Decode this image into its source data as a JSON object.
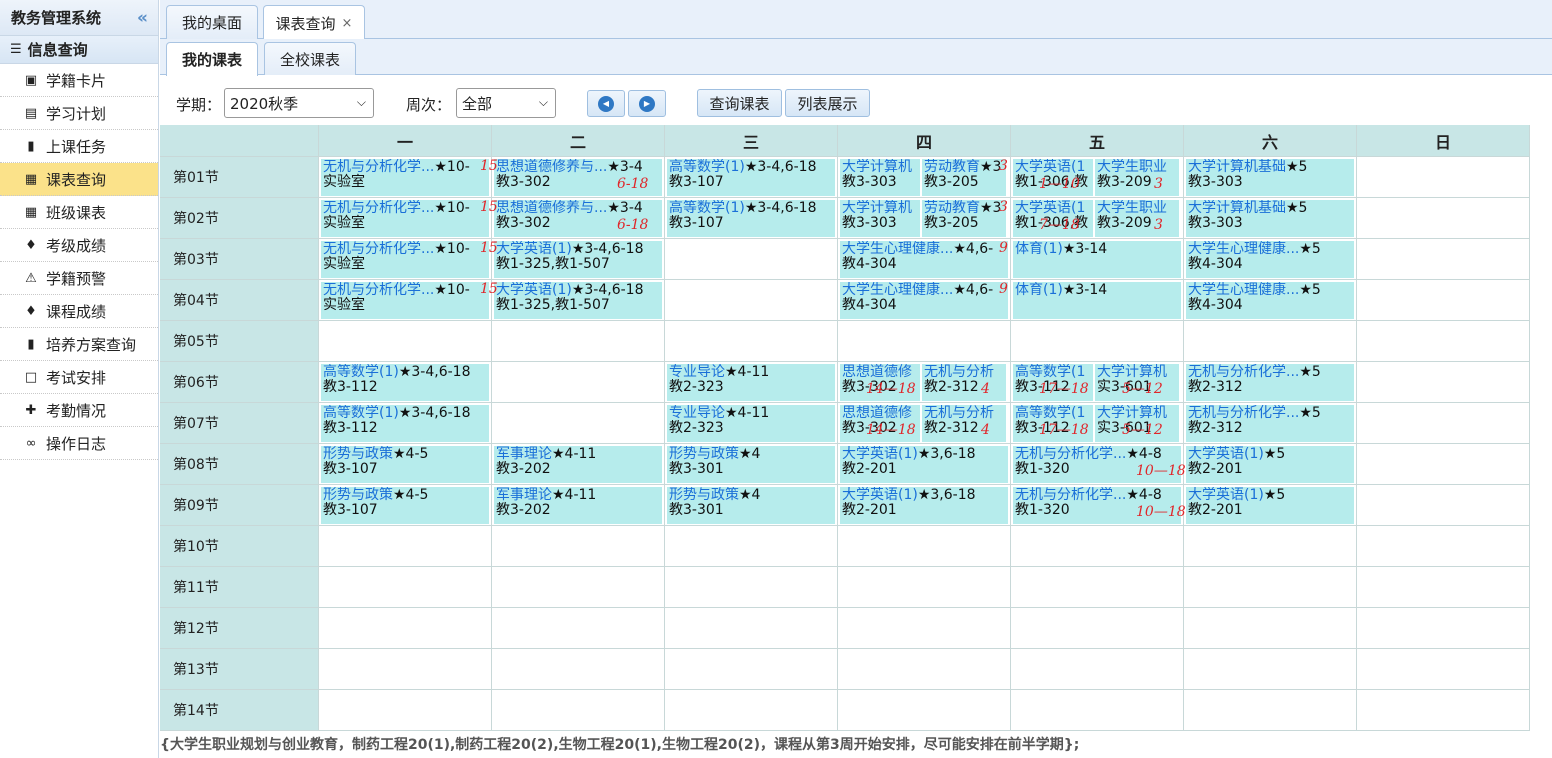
{
  "sidebar": {
    "title": "教务管理系统",
    "collapse_icon": "double-chevron-left-icon",
    "group": "信息查询",
    "items": [
      {
        "label": "学籍卡片",
        "icon": "id-card-icon",
        "glyph": "▣"
      },
      {
        "label": "学习计划",
        "icon": "keyboard-icon",
        "glyph": "▤"
      },
      {
        "label": "上课任务",
        "icon": "book-icon",
        "glyph": "▮"
      },
      {
        "label": "课表查询",
        "icon": "calendar-icon",
        "glyph": "▦"
      },
      {
        "label": "班级课表",
        "icon": "calendar-icon",
        "glyph": "▦"
      },
      {
        "label": "考级成绩",
        "icon": "graduation-cap-icon",
        "glyph": "♦"
      },
      {
        "label": "学籍预警",
        "icon": "warning-icon",
        "glyph": "⚠"
      },
      {
        "label": "课程成绩",
        "icon": "graduation-cap-icon",
        "glyph": "♦"
      },
      {
        "label": "培养方案查询",
        "icon": "book-icon",
        "glyph": "▮"
      },
      {
        "label": "考试安排",
        "icon": "calendar-empty-icon",
        "glyph": "□"
      },
      {
        "label": "考勤情况",
        "icon": "user-plus-icon",
        "glyph": "✚"
      },
      {
        "label": "操作日志",
        "icon": "binoculars-icon",
        "glyph": "∞"
      }
    ],
    "active_index": 3
  },
  "tabs": {
    "home": "我的桌面",
    "current": "课表查询",
    "close": "×"
  },
  "subtabs": {
    "mine": "我的课表",
    "school": "全校课表"
  },
  "toolbar": {
    "term_label": "学期：",
    "term_value": "2020秋季",
    "week_label": "周次：",
    "week_value": "全部",
    "query_button": "查询课表",
    "list_button": "列表展示",
    "accent": "#2f78c4"
  },
  "timetable": {
    "days": [
      "一",
      "二",
      "三",
      "四",
      "五",
      "六",
      "日"
    ],
    "periods": [
      "第01节",
      "第02节",
      "第03节",
      "第04节",
      "第05节",
      "第06节",
      "第07节",
      "第08节",
      "第09节",
      "第10节",
      "第11节",
      "第12节",
      "第13节",
      "第14节"
    ],
    "courses": [
      {
        "day": 0,
        "period": 0,
        "name": "无机与分析化学...",
        "tail": "★10-",
        "room": "实验室"
      },
      {
        "day": 0,
        "period": 1,
        "name": "无机与分析化学...",
        "tail": "★10-",
        "room": "实验室"
      },
      {
        "day": 0,
        "period": 2,
        "name": "无机与分析化学...",
        "tail": "★10-",
        "room": "实验室"
      },
      {
        "day": 0,
        "period": 3,
        "name": "无机与分析化学...",
        "tail": "★10-",
        "room": "实验室"
      },
      {
        "day": 0,
        "period": 5,
        "name": "高等数学(1)",
        "tail": "★3-4,6-18",
        "room": "教3-112"
      },
      {
        "day": 0,
        "period": 6,
        "name": "高等数学(1)",
        "tail": "★3-4,6-18",
        "room": "教3-112"
      },
      {
        "day": 0,
        "period": 7,
        "name": "形势与政策",
        "tail": "★4-5",
        "room": "教3-107"
      },
      {
        "day": 0,
        "period": 8,
        "name": "形势与政策",
        "tail": "★4-5",
        "room": "教3-107"
      },
      {
        "day": 1,
        "period": 0,
        "name": "思想道德修养与...",
        "tail": "★3-4",
        "room": "教3-302"
      },
      {
        "day": 1,
        "period": 1,
        "name": "思想道德修养与...",
        "tail": "★3-4",
        "room": "教3-302"
      },
      {
        "day": 1,
        "period": 2,
        "name": "大学英语(1)",
        "tail": "★3-4,6-18",
        "room": "教1-325,教1-507"
      },
      {
        "day": 1,
        "period": 3,
        "name": "大学英语(1)",
        "tail": "★3-4,6-18",
        "room": "教1-325,教1-507"
      },
      {
        "day": 1,
        "period": 7,
        "name": "军事理论",
        "tail": "★4-11",
        "room": "教3-202"
      },
      {
        "day": 1,
        "period": 8,
        "name": "军事理论",
        "tail": "★4-11",
        "room": "教3-202"
      },
      {
        "day": 2,
        "period": 0,
        "name": "高等数学(1)",
        "tail": "★3-4,6-18",
        "room": "教3-107"
      },
      {
        "day": 2,
        "period": 1,
        "name": "高等数学(1)",
        "tail": "★3-4,6-18",
        "room": "教3-107"
      },
      {
        "day": 2,
        "period": 5,
        "name": "专业导论",
        "tail": "★4-11",
        "room": "教2-323"
      },
      {
        "day": 2,
        "period": 6,
        "name": "专业导论",
        "tail": "★4-11",
        "room": "教2-323"
      },
      {
        "day": 2,
        "period": 7,
        "name": "形势与政策",
        "tail": "★4",
        "room": "教3-301"
      },
      {
        "day": 2,
        "period": 8,
        "name": "形势与政策",
        "tail": "★4",
        "room": "教3-301"
      },
      {
        "day": 3,
        "period": 0,
        "name": "大学计算机",
        "tail": "",
        "room": "教3-303",
        "half": 0
      },
      {
        "day": 3,
        "period": 0,
        "name": "劳动教育",
        "tail": "★3",
        "room": "教3-205",
        "half": 1
      },
      {
        "day": 3,
        "period": 1,
        "name": "大学计算机",
        "tail": "",
        "room": "教3-303",
        "half": 0
      },
      {
        "day": 3,
        "period": 1,
        "name": "劳动教育",
        "tail": "★3",
        "room": "教3-205",
        "half": 1
      },
      {
        "day": 3,
        "period": 2,
        "name": "大学生心理健康...",
        "tail": "★4,6-",
        "room": "教4-304"
      },
      {
        "day": 3,
        "period": 3,
        "name": "大学生心理健康...",
        "tail": "★4,6-",
        "room": "教4-304"
      },
      {
        "day": 3,
        "period": 5,
        "name": "思想道德修",
        "tail": "",
        "room": "教3-302",
        "half": 0
      },
      {
        "day": 3,
        "period": 5,
        "name": "无机与分析",
        "tail": "",
        "room": "教2-312",
        "half": 1
      },
      {
        "day": 3,
        "period": 6,
        "name": "思想道德修",
        "tail": "",
        "room": "教3-302",
        "half": 0
      },
      {
        "day": 3,
        "period": 6,
        "name": "无机与分析",
        "tail": "",
        "room": "教2-312",
        "half": 1
      },
      {
        "day": 3,
        "period": 7,
        "name": "大学英语(1)",
        "tail": "★3,6-18",
        "room": "教2-201"
      },
      {
        "day": 3,
        "period": 8,
        "name": "大学英语(1)",
        "tail": "★3,6-18",
        "room": "教2-201"
      },
      {
        "day": 4,
        "period": 0,
        "name": "大学英语(1",
        "tail": "",
        "room": "教1-306,教",
        "half": 0
      },
      {
        "day": 4,
        "period": 0,
        "name": "大学生职业",
        "tail": "",
        "room": "教3-209",
        "half": 1
      },
      {
        "day": 4,
        "period": 1,
        "name": "大学英语(1",
        "tail": "",
        "room": "教1-306,教",
        "half": 0
      },
      {
        "day": 4,
        "period": 1,
        "name": "大学生职业",
        "tail": "",
        "room": "教3-209",
        "half": 1
      },
      {
        "day": 4,
        "period": 2,
        "name": "体育(1)",
        "tail": "★3-14",
        "room": ""
      },
      {
        "day": 4,
        "period": 3,
        "name": "体育(1)",
        "tail": "★3-14",
        "room": ""
      },
      {
        "day": 4,
        "period": 5,
        "name": "高等数学(1",
        "tail": "",
        "room": "教3-112",
        "half": 0
      },
      {
        "day": 4,
        "period": 5,
        "name": "大学计算机",
        "tail": "",
        "room": "实3-601",
        "half": 1
      },
      {
        "day": 4,
        "period": 6,
        "name": "高等数学(1",
        "tail": "",
        "room": "教3-112",
        "half": 0
      },
      {
        "day": 4,
        "period": 6,
        "name": "大学计算机",
        "tail": "",
        "room": "实3-601",
        "half": 1
      },
      {
        "day": 4,
        "period": 7,
        "name": "无机与分析化学...",
        "tail": "★4-8",
        "room": "教1-320"
      },
      {
        "day": 4,
        "period": 8,
        "name": "无机与分析化学...",
        "tail": "★4-8",
        "room": "教1-320"
      },
      {
        "day": 5,
        "period": 0,
        "name": "大学计算机基础",
        "tail": "★5",
        "room": "教3-303"
      },
      {
        "day": 5,
        "period": 1,
        "name": "大学计算机基础",
        "tail": "★5",
        "room": "教3-303"
      },
      {
        "day": 5,
        "period": 2,
        "name": "大学生心理健康...",
        "tail": "★5",
        "room": "教4-304"
      },
      {
        "day": 5,
        "period": 3,
        "name": "大学生心理健康...",
        "tail": "★5",
        "room": "教4-304"
      },
      {
        "day": 5,
        "period": 5,
        "name": "无机与分析化学...",
        "tail": "★5",
        "room": "教2-312"
      },
      {
        "day": 5,
        "period": 6,
        "name": "无机与分析化学...",
        "tail": "★5",
        "room": "教2-312"
      },
      {
        "day": 5,
        "period": 7,
        "name": "大学英语(1)",
        "tail": "★5",
        "room": "教2-201"
      },
      {
        "day": 5,
        "period": 8,
        "name": "大学英语(1)",
        "tail": "★5",
        "room": "教2-201"
      }
    ],
    "annotations": [
      {
        "day": 0,
        "period": 0,
        "text": "15",
        "pos": "tr"
      },
      {
        "day": 0,
        "period": 1,
        "text": "15",
        "pos": "tr"
      },
      {
        "day": 0,
        "period": 2,
        "text": "15",
        "pos": "tr"
      },
      {
        "day": 0,
        "period": 3,
        "text": "15",
        "pos": "tr"
      },
      {
        "day": 1,
        "period": 0,
        "text": "6-18",
        "pos": "br"
      },
      {
        "day": 1,
        "period": 1,
        "text": "6-18",
        "pos": "br"
      },
      {
        "day": 3,
        "period": 0,
        "text": "3",
        "pos": "tr"
      },
      {
        "day": 3,
        "period": 1,
        "text": "3",
        "pos": "tr"
      },
      {
        "day": 3,
        "period": 2,
        "text": "9",
        "pos": "tr"
      },
      {
        "day": 3,
        "period": 3,
        "text": "9",
        "pos": "tr"
      },
      {
        "day": 3,
        "period": 5,
        "text": "14—18",
        "pos": "bl"
      },
      {
        "day": 3,
        "period": 5,
        "text": "4",
        "pos": "brh"
      },
      {
        "day": 3,
        "period": 6,
        "text": "14—18",
        "pos": "bl"
      },
      {
        "day": 3,
        "period": 6,
        "text": "4",
        "pos": "brh"
      },
      {
        "day": 4,
        "period": 0,
        "text": "1—10",
        "pos": "bl"
      },
      {
        "day": 4,
        "period": 0,
        "text": "3",
        "pos": "brh"
      },
      {
        "day": 4,
        "period": 1,
        "text": "7—18",
        "pos": "bl"
      },
      {
        "day": 4,
        "period": 1,
        "text": "3",
        "pos": "brh"
      },
      {
        "day": 4,
        "period": 5,
        "text": "17—18",
        "pos": "bl"
      },
      {
        "day": 4,
        "period": 5,
        "text": "5—12",
        "pos": "brh"
      },
      {
        "day": 4,
        "period": 6,
        "text": "17—18",
        "pos": "bl"
      },
      {
        "day": 4,
        "period": 6,
        "text": "5—12",
        "pos": "brh"
      },
      {
        "day": 4,
        "period": 7,
        "text": "10—18",
        "pos": "br"
      },
      {
        "day": 4,
        "period": 8,
        "text": "10—18",
        "pos": "br"
      }
    ]
  },
  "footnote": "{大学生职业规划与创业教育，制药工程20(1),制药工程20(2),生物工程20(1),生物工程20(2)，课程从第3周开始安排，尽可能安排在前半学期};"
}
